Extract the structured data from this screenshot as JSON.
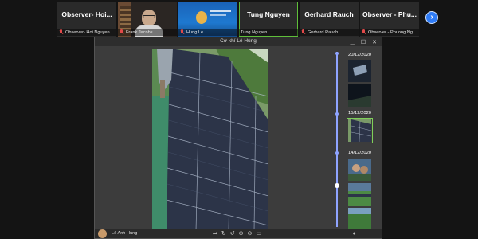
{
  "participants": [
    {
      "big_name": "Observer- Hoi...",
      "caption": "Observer- Hoi Nguyen...",
      "muted": true,
      "video": "none"
    },
    {
      "big_name": "",
      "caption": "Frank Jacobs",
      "muted": true,
      "video": "camera"
    },
    {
      "big_name": "",
      "caption": "Hung Le",
      "muted": true,
      "video": "presentation"
    },
    {
      "big_name": "Tung Nguyen",
      "caption": "Tung Nguyen",
      "muted": false,
      "video": "none",
      "active": true
    },
    {
      "big_name": "Gerhard Rauch",
      "caption": "Gerhard Rauch",
      "muted": true,
      "video": "none"
    },
    {
      "big_name": "Observer - Phu...",
      "caption": "Observer - Phuong Ng...",
      "muted": true,
      "video": "none"
    }
  ],
  "window": {
    "title": "Cơ khí Lê Hùng",
    "controls": {
      "minimize": "▁",
      "maximize": "☐",
      "close": "✕"
    }
  },
  "timeline": {
    "groups": [
      {
        "date": "20/12/2020",
        "thumbs": [
          "night-panel",
          "night-dark"
        ]
      },
      {
        "date": "15/12/2020",
        "thumbs": [
          "solar-roof-selected"
        ]
      },
      {
        "date": "14/12/2020",
        "thumbs": [
          "workers",
          "field",
          "green"
        ]
      }
    ]
  },
  "bottom": {
    "author": "Lê Anh Hùng",
    "tool_icons": [
      "➦",
      "↻",
      "↺",
      "⊕",
      "⊖",
      "▭"
    ],
    "right_icons": [
      "◐",
      "⋯",
      "⋮"
    ]
  },
  "colors": {
    "next_button": "#2f7cf6",
    "active_tile_border": "#5fbf3a",
    "timeline": "#8fa4ff",
    "muted_mic": "#e24a4a"
  }
}
